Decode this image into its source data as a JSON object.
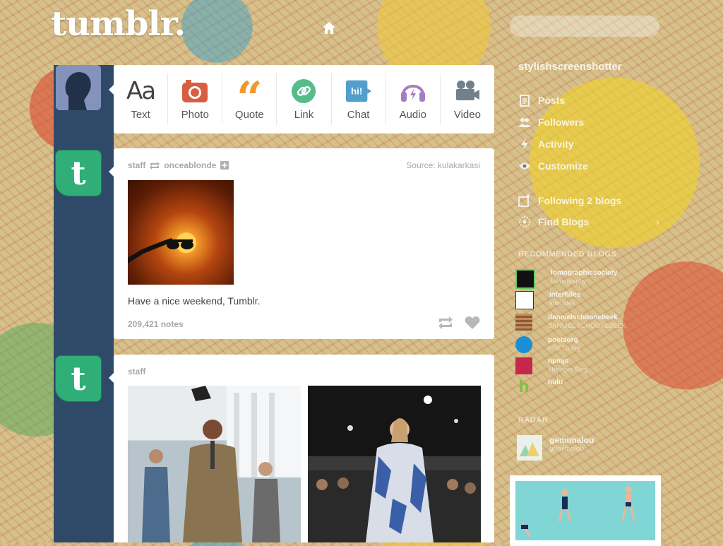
{
  "header": {
    "logo": "tumblr."
  },
  "post_bar": {
    "items": [
      {
        "label": "Text",
        "icon": "text-icon"
      },
      {
        "label": "Photo",
        "icon": "camera-icon"
      },
      {
        "label": "Quote",
        "icon": "quote-icon"
      },
      {
        "label": "Link",
        "icon": "link-icon"
      },
      {
        "label": "Chat",
        "icon": "chat-icon"
      },
      {
        "label": "Audio",
        "icon": "headphones-icon"
      },
      {
        "label": "Video",
        "icon": "video-camera-icon"
      }
    ],
    "colors": {
      "Text": "#444444",
      "Photo": "#d95e40",
      "Quote": "#f2992e",
      "Link": "#56bc8a",
      "Chat": "#529ecc",
      "Audio": "#a77dc2",
      "Video": "#748089"
    }
  },
  "posts": [
    {
      "author": "staff",
      "reblogged_from": "onceablonde",
      "source_label": "Source:",
      "source": "kulakarkasi",
      "caption": "Have a nice weekend, Tumblr.",
      "notes": "209,421 notes"
    },
    {
      "author": "staff"
    }
  ],
  "sidebar": {
    "blog_name": "stylishscreenshotter",
    "nav": [
      "Posts",
      "Followers",
      "Activity",
      "Customize"
    ],
    "following": "Following 2 blogs",
    "find_blogs": "Find Blogs",
    "recommended_title": "RECOMMENDED BLOGS",
    "recommended": [
      {
        "name": "lomographicsociety",
        "sub": "Lomography"
      },
      {
        "name": "interfilles",
        "sub": "Interfilles"
      },
      {
        "name": "dannielschoonebeek",
        "sub": "DANNIEL SCHOONEBEEK"
      },
      {
        "name": "poetsorg",
        "sub": "POETS.org"
      },
      {
        "name": "npmjs",
        "sub": "The npm Blog"
      },
      {
        "name": "hulu",
        "sub": ""
      }
    ],
    "radar_title": "RADAR",
    "radar_blog": {
      "name": "gemimalou",
      "sub": "gemimalou"
    }
  }
}
